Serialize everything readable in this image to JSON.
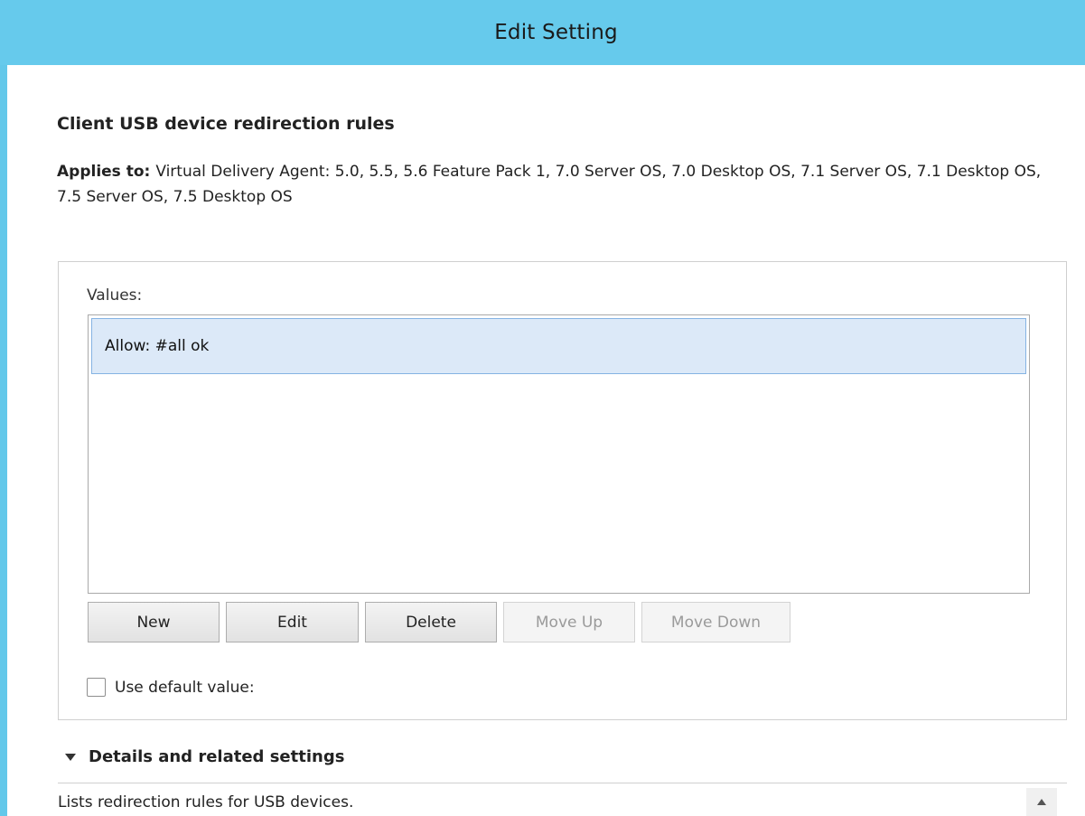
{
  "window": {
    "title": "Edit Setting"
  },
  "setting": {
    "heading": "Client USB device redirection rules",
    "applies_label": "Applies to:",
    "applies_text": "Virtual Delivery Agent: 5.0, 5.5, 5.6 Feature Pack 1, 7.0 Server OS, 7.0 Desktop OS, 7.1 Server OS, 7.1 Desktop OS, 7.5 Server OS, 7.5 Desktop OS"
  },
  "values": {
    "label": "Values:",
    "items": [
      {
        "text": "Allow: #all ok",
        "selected": true
      }
    ]
  },
  "buttons": {
    "new": "New",
    "edit": "Edit",
    "delete": "Delete",
    "move_up": "Move Up",
    "move_down": "Move Down"
  },
  "default_value": {
    "label": "Use default value:",
    "checked": false
  },
  "details": {
    "header": "Details and related settings",
    "description": "Lists redirection rules for USB devices."
  },
  "colors": {
    "title_bar": "#66caec",
    "selection_bg": "#dce9f8",
    "selection_border": "#85b3e3"
  },
  "icons": {
    "details_toggle": "triangle-down-icon",
    "scroll_up": "scroll-up-arrow-icon"
  }
}
